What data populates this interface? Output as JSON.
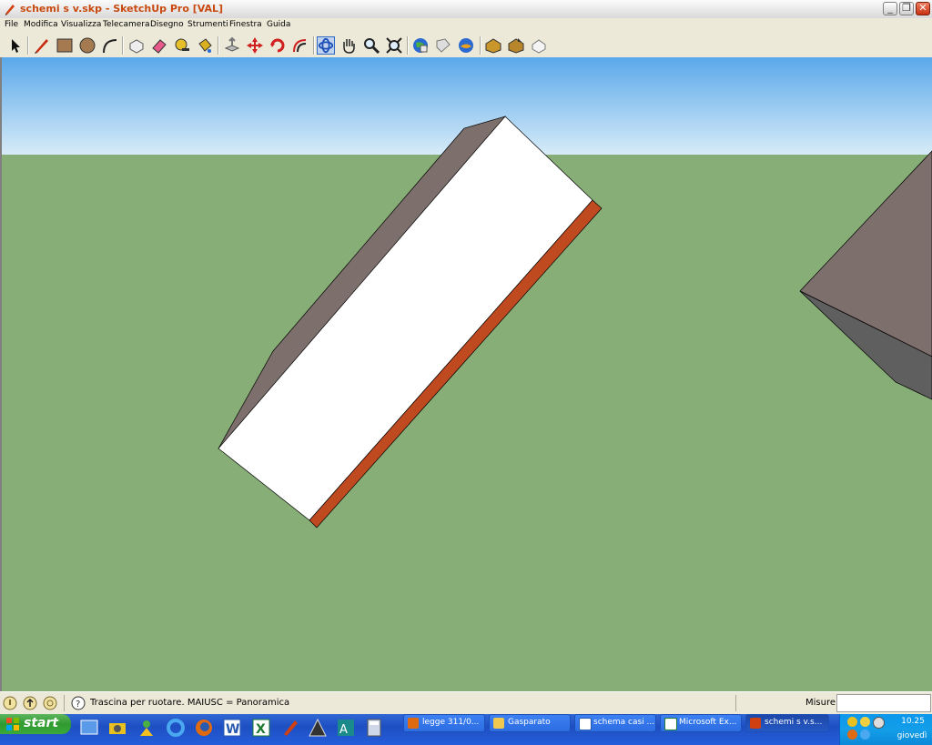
{
  "window": {
    "title": "schemi s v.skp - SketchUp Pro [VAL]",
    "minimize_glyph": "_",
    "maximize_glyph": "❐",
    "close_glyph": "✕"
  },
  "menu": {
    "items": [
      "File",
      "Modifica",
      "Visualizza",
      "Telecamera",
      "Disegno",
      "Strumenti",
      "Finestra",
      "Guida"
    ]
  },
  "toolbar": {
    "tools": [
      {
        "name": "select-tool-icon",
        "active": false
      },
      {
        "name": "pencil-tool-icon",
        "active": false
      },
      {
        "name": "rectangle-tool-icon",
        "active": false
      },
      {
        "name": "circle-tool-icon",
        "active": false
      },
      {
        "name": "arc-tool-icon",
        "active": false
      },
      {
        "name": "make-component-icon",
        "active": false
      },
      {
        "name": "eraser-tool-icon",
        "active": false
      },
      {
        "name": "tape-measure-icon",
        "active": false
      },
      {
        "name": "paint-bucket-icon",
        "active": false
      },
      {
        "name": "push-pull-icon",
        "active": false
      },
      {
        "name": "move-tool-icon",
        "active": false
      },
      {
        "name": "rotate-tool-icon",
        "active": false
      },
      {
        "name": "offset-tool-icon",
        "active": false
      },
      {
        "name": "orbit-tool-icon",
        "active": true
      },
      {
        "name": "pan-tool-icon",
        "active": false
      },
      {
        "name": "zoom-tool-icon",
        "active": false
      },
      {
        "name": "zoom-extents-icon",
        "active": false
      },
      {
        "name": "get-models-icon",
        "active": false
      },
      {
        "name": "share-model-icon",
        "active": false
      },
      {
        "name": "google-earth-icon",
        "active": false
      },
      {
        "name": "components-warehouse-icon",
        "active": false
      },
      {
        "name": "share-component-icon",
        "active": false
      },
      {
        "name": "extension-warehouse-icon",
        "active": false
      }
    ]
  },
  "colors": {
    "sky_top": "#5aa8ea",
    "sky_bottom": "#d8ecf8",
    "ground": "#88ae78",
    "box_top_face": "#ffffff",
    "box_side_face": "#7d6f6c",
    "box_edge_face": "#c04a20",
    "right_object_light": "#7d6f6c",
    "right_object_dark": "#5f5f5f"
  },
  "statusbar": {
    "hint": "Trascina per ruotare. MAIUSC = Panoramica",
    "measure_label": "Misure",
    "measure_value": ""
  },
  "taskbar": {
    "start_label": "start",
    "quick_launch": [
      "show-desktop-icon",
      "camera-icon",
      "messenger-icon",
      "internet-explorer-icon",
      "firefox-icon",
      "word-icon",
      "excel-icon",
      "sketchup-icon",
      "autocad-icon",
      "autocad-lt-icon",
      "calculator-icon"
    ],
    "tasks": [
      {
        "label": "legge 311/0...",
        "icon": "firefox-icon",
        "active": false
      },
      {
        "label": "Gasparato",
        "icon": "folder-icon",
        "active": false
      },
      {
        "label": "schema casi ...",
        "icon": "word-icon",
        "active": false
      },
      {
        "label": "Microsoft Ex...",
        "icon": "excel-icon",
        "active": false
      },
      {
        "label": "schemi s v.s...",
        "icon": "sketchup-icon",
        "active": true
      }
    ],
    "clock": "10.25",
    "day": "giovedì"
  }
}
